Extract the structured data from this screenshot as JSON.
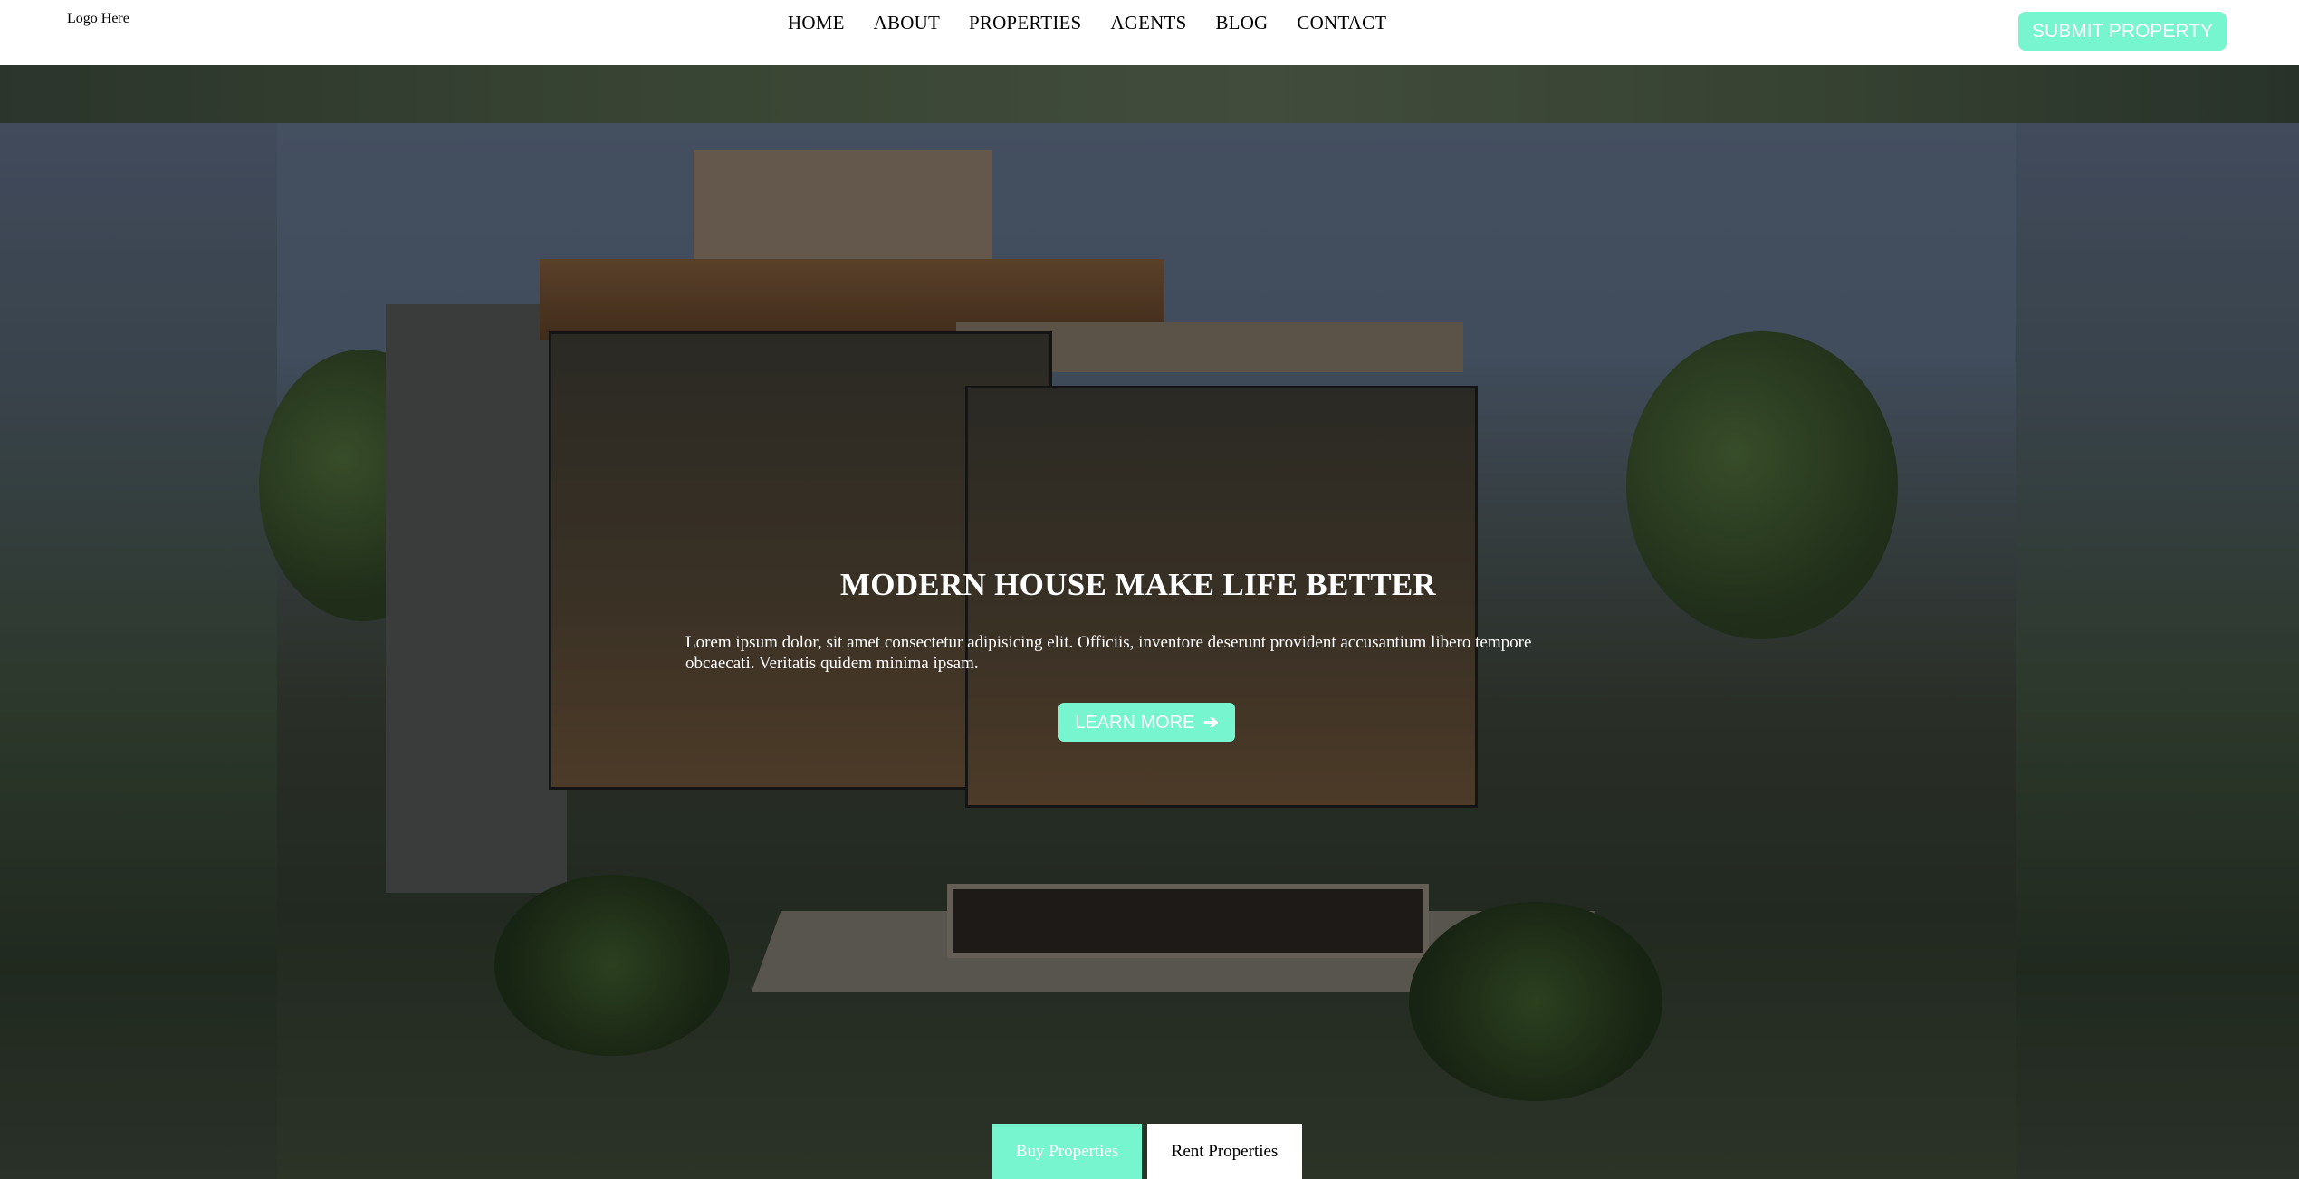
{
  "header": {
    "logo": "Logo Here",
    "nav": [
      "HOME",
      "ABOUT",
      "PROPERTIES",
      "AGENTS",
      "BLOG",
      "CONTACT"
    ],
    "cta": "SUBMIT PROPERTY"
  },
  "hero": {
    "title": "MODERN HOUSE MAKE LIFE BETTER",
    "text": "Lorem ipsum dolor, sit amet consectetur adipisicing elit. Officiis, inventore deserunt provident accusantium libero tempore obcaecati. Veritatis quidem minima ipsam.",
    "button": "LEARN MORE",
    "button_icon": "arrow-right-icon"
  },
  "tabs": {
    "buy": "Buy Properties",
    "rent": "Rent Properties",
    "active": "buy"
  },
  "colors": {
    "accent": "#77f5cf",
    "header_bg": "#ffffff"
  }
}
